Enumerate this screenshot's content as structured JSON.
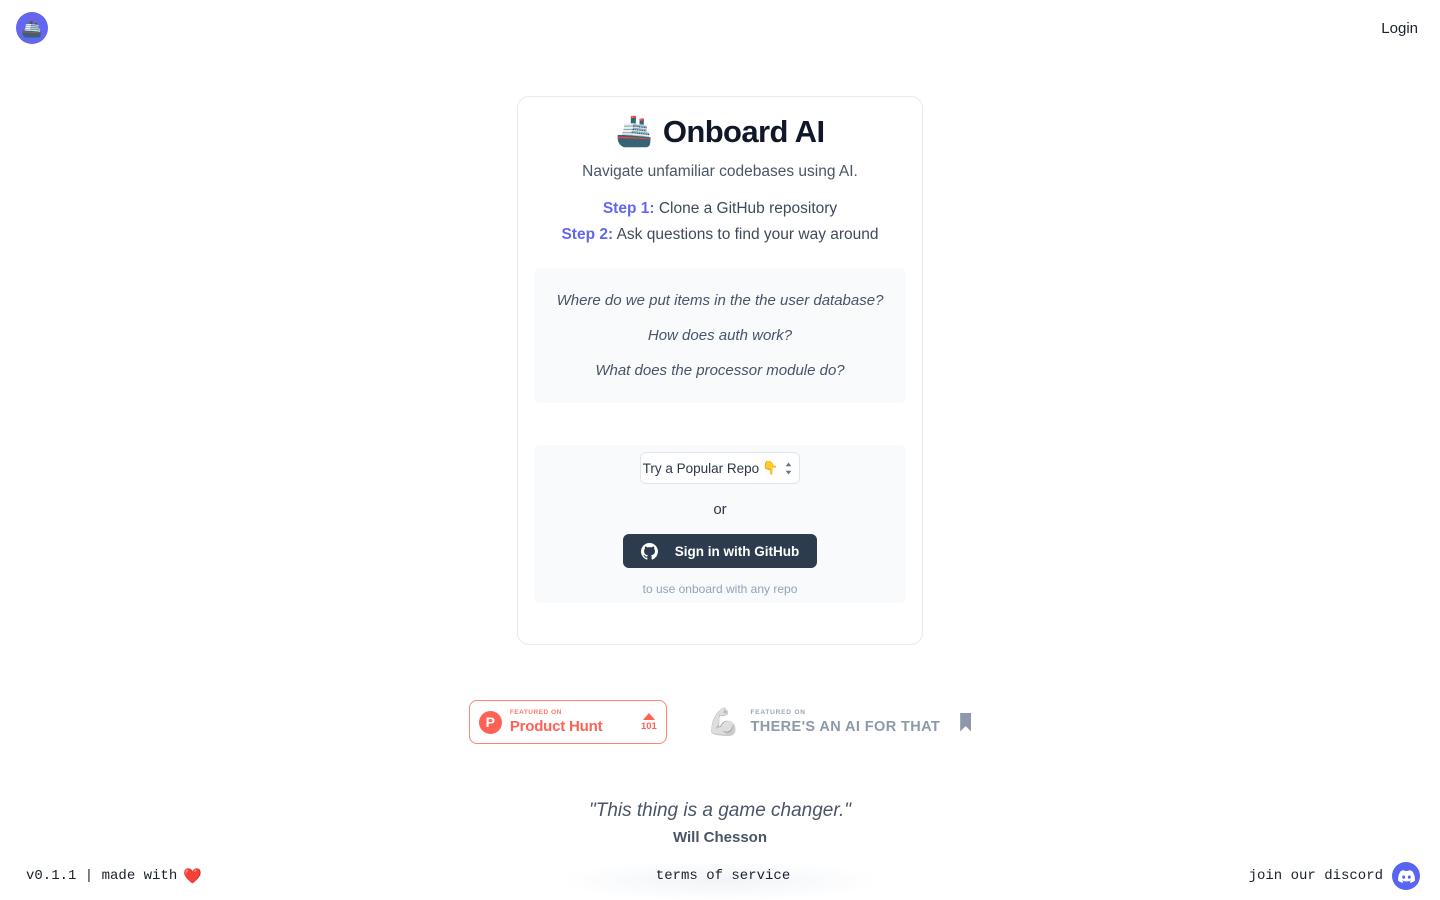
{
  "topbar": {
    "logo_emoji": "🚢",
    "logo_name": "onboard-ai-logo",
    "login_label": "Login"
  },
  "card": {
    "brand_emoji": "🚢",
    "brand_title": "Onboard AI",
    "tagline": "Navigate unfamiliar codebases using AI.",
    "steps": [
      {
        "label": "Step 1:",
        "text": "Clone a GitHub repository"
      },
      {
        "label": "Step 2:",
        "text": "Ask questions to find your way around"
      }
    ],
    "questions": [
      "Where do we put items in the the user database?",
      "How does auth work?",
      "What does the processor module do?"
    ],
    "actions": {
      "select_value": "Try a Popular Repo",
      "select_emoji": "👇",
      "or_label": "or",
      "github_button_label": "Sign in with GitHub",
      "github_sub_label": "to use onboard with any repo"
    }
  },
  "badges": {
    "product_hunt": {
      "mark": "P",
      "featured_label": "FEATURED ON",
      "name": "Product Hunt",
      "upvotes": "101"
    },
    "theres_an_ai_for_that": {
      "icon": "💪",
      "featured_label": "FEATURED ON",
      "name": "THERE'S AN AI FOR THAT"
    }
  },
  "testimonial": {
    "quote": "\"This thing is a game changer.\"",
    "author": "Will Chesson"
  },
  "footer": {
    "version_text": "v0.1.1 | made with",
    "heart": "❤️",
    "terms_label": "terms of service",
    "discord_label": "join our discord"
  },
  "colors": {
    "accent_indigo": "#6366f1",
    "github_dark": "#2d3b4e",
    "product_hunt_red": "#ff6154",
    "discord_purple": "#5865f2",
    "panel_bg": "#f8fafc",
    "card_border": "#e4eaf2"
  }
}
